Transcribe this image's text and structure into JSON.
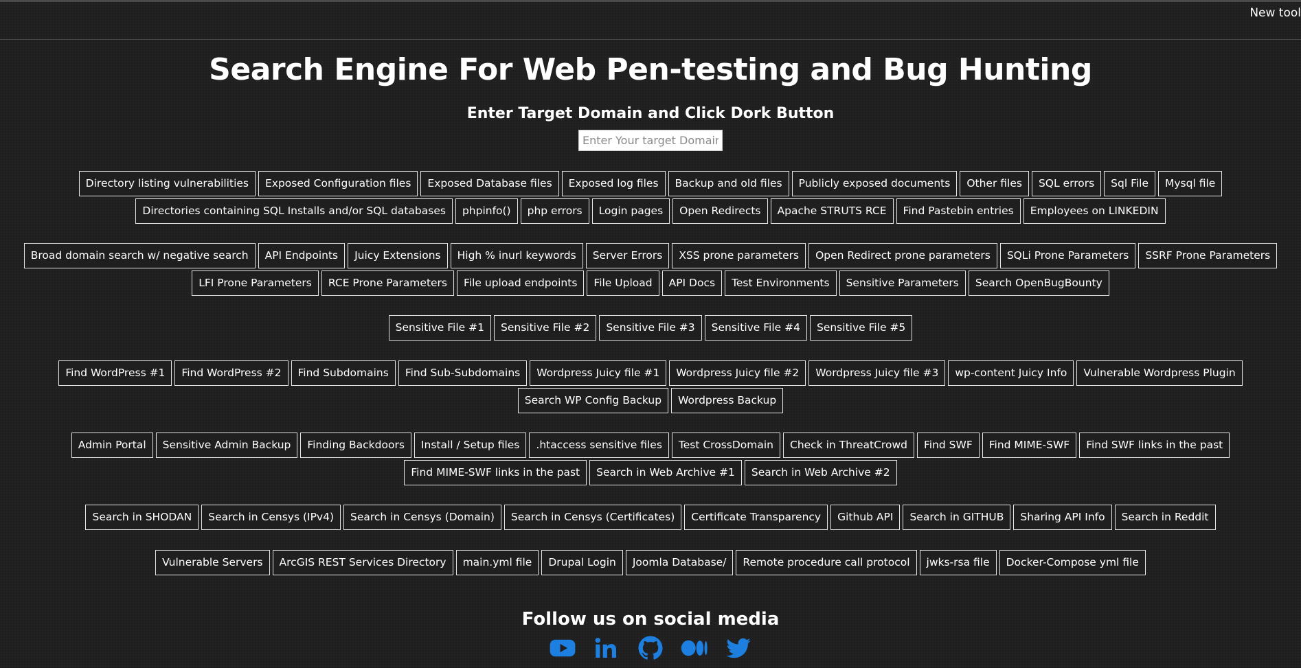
{
  "header": {
    "new_tool": "New tool"
  },
  "title": "Search Engine For Web Pen-testing and Bug Hunting",
  "subtitle": "Enter Target Domain and Click Dork Button",
  "search": {
    "placeholder": "Enter Your target Domain",
    "value": ""
  },
  "groups": [
    {
      "buttons": [
        "Directory listing vulnerabilities",
        "Exposed Configuration files",
        "Exposed Database files",
        "Exposed log files",
        "Backup and old files",
        "Publicly exposed documents",
        "Other files",
        "SQL errors",
        "Sql File",
        "Mysql file",
        "Directories containing SQL Installs and/or SQL databases",
        "phpinfo()",
        "php errors",
        "Login pages",
        "Open Redirects",
        "Apache STRUTS RCE",
        "Find Pastebin entries",
        "Employees on LINKEDIN"
      ]
    },
    {
      "buttons": [
        "Broad domain search w/ negative search",
        "API Endpoints",
        "Juicy Extensions",
        "High % inurl keywords",
        "Server Errors",
        "XSS prone parameters",
        "Open Redirect prone parameters",
        "SQLi Prone Parameters",
        "SSRF Prone Parameters",
        "LFI Prone Parameters",
        "RCE Prone Parameters",
        "File upload endpoints",
        "File Upload",
        "API Docs",
        "Test Environments",
        "Sensitive Parameters",
        "Search OpenBugBounty"
      ]
    },
    {
      "buttons": [
        "Sensitive File #1",
        "Sensitive File #2",
        "Sensitive File #3",
        "Sensitive File #4",
        "Sensitive File #5"
      ]
    },
    {
      "buttons": [
        "Find WordPress #1",
        "Find WordPress #2",
        "Find Subdomains",
        "Find Sub-Subdomains",
        "Wordpress Juicy file #1",
        "Wordpress Juicy file #2",
        "Wordpress Juicy file #3",
        "wp-content Juicy Info",
        "Vulnerable Wordpress Plugin",
        "Search WP Config Backup",
        "Wordpress Backup"
      ]
    },
    {
      "buttons": [
        "Admin Portal",
        "Sensitive Admin Backup",
        "Finding Backdoors",
        "Install / Setup files",
        ".htaccess sensitive files",
        "Test CrossDomain",
        "Check in ThreatCrowd",
        "Find SWF",
        "Find MIME-SWF",
        "Find SWF links in the past",
        "Find MIME-SWF links in the past",
        "Search in Web Archive #1",
        "Search in Web Archive #2"
      ]
    },
    {
      "buttons": [
        "Search in SHODAN",
        "Search in Censys (IPv4)",
        "Search in Censys (Domain)",
        "Search in Censys (Certificates)",
        "Certificate Transparency",
        "Github API",
        "Search in GITHUB",
        "Sharing API Info",
        "Search in Reddit"
      ]
    },
    {
      "buttons": [
        "Vulnerable Servers",
        "ArcGIS REST Services Directory",
        "main.yml file",
        "Drupal Login",
        "Joomla Database/",
        "Remote procedure call protocol",
        "jwks-rsa file",
        "Docker-Compose yml file"
      ]
    }
  ],
  "follow": "Follow us on social media",
  "social": [
    {
      "icon": "youtube-icon"
    },
    {
      "icon": "linkedin-icon"
    },
    {
      "icon": "github-icon"
    },
    {
      "icon": "medium-icon"
    },
    {
      "icon": "twitter-icon"
    }
  ],
  "colors": {
    "background": "#1f1f1f",
    "text": "#ffffff",
    "button_border": "#e6e6e6",
    "social": "#1d7fe0"
  }
}
